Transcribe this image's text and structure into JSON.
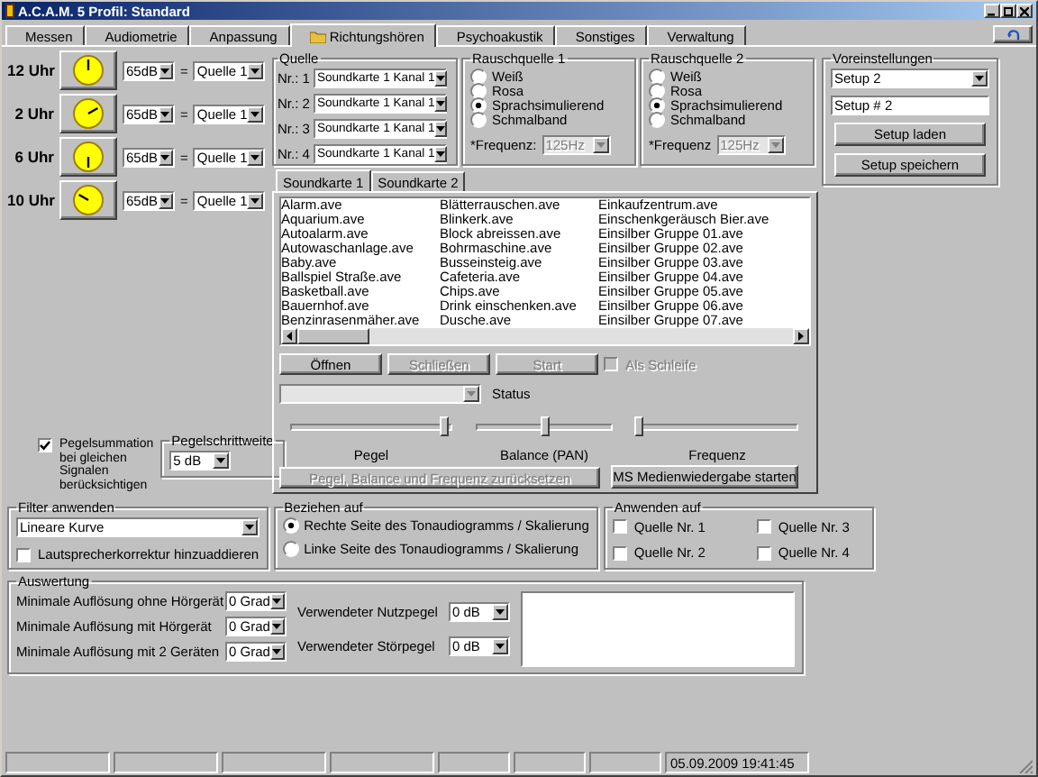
{
  "window": {
    "title": "A.C.A.M. 5 Profil: Standard"
  },
  "tabs": [
    {
      "label": "Messen",
      "selected": false
    },
    {
      "label": "Audiometrie",
      "selected": false
    },
    {
      "label": "Anpassung",
      "selected": false
    },
    {
      "label": "Richtungshören",
      "selected": true
    },
    {
      "label": "Psychoakustik",
      "selected": false
    },
    {
      "label": "Sonstiges",
      "selected": false
    },
    {
      "label": "Verwaltung",
      "selected": false
    }
  ],
  "clocks": [
    {
      "label": "12 Uhr",
      "kind": "twelve",
      "pegel": "65dB",
      "separator": "=",
      "source": "Quelle 1"
    },
    {
      "label": "2 Uhr",
      "kind": "two",
      "pegel": "65dB",
      "separator": "=",
      "source": "Quelle 1"
    },
    {
      "label": "6 Uhr",
      "kind": "six",
      "pegel": "65dB",
      "separator": "=",
      "source": "Quelle 1"
    },
    {
      "label": "10 Uhr",
      "kind": "ten",
      "pegel": "65dB",
      "separator": "=",
      "source": "Quelle 1"
    }
  ],
  "quelle": {
    "title": "Quelle",
    "rows": [
      {
        "label": "Nr.: 1",
        "value": "Soundkarte 1 Kanal 1"
      },
      {
        "label": "Nr.: 2",
        "value": "Soundkarte 1 Kanal 1"
      },
      {
        "label": "Nr.: 3",
        "value": "Soundkarte 1 Kanal 1"
      },
      {
        "label": "Nr.: 4",
        "value": "Soundkarte 1 Kanal 1"
      }
    ]
  },
  "rauschquelle_1": {
    "title": "Rauschquelle 1",
    "options": [
      {
        "label": "Weiß",
        "selected": false
      },
      {
        "label": "Rosa",
        "selected": false
      },
      {
        "label": "Sprachsimulierend",
        "selected": true
      },
      {
        "label": "Schmalband",
        "selected": false
      }
    ],
    "frequency": {
      "label": "*Frequenz:",
      "value": "125Hz",
      "disabled": true
    }
  },
  "rauschquelle_2": {
    "title": "Rauschquelle 2",
    "options": [
      {
        "label": "Weiß",
        "selected": false
      },
      {
        "label": "Rosa",
        "selected": false
      },
      {
        "label": "Sprachsimulierend",
        "selected": true
      },
      {
        "label": "Schmalband",
        "selected": false
      }
    ],
    "frequency": {
      "label": "*Frequenz",
      "value": "125Hz",
      "disabled": true
    }
  },
  "voreinstellungen": {
    "title": "Voreinstellungen",
    "select": "Setup 2",
    "name": "Setup # 2",
    "buttons": [
      "Setup laden",
      "Setup speichern"
    ]
  },
  "sound_tabs": [
    {
      "label": "Soundkarte 1",
      "selected": true
    },
    {
      "label": "Soundkarte 2",
      "selected": false
    }
  ],
  "file_list": {
    "columns": [
      [
        "Alarm.ave",
        "Aquarium.ave",
        "Autoalarm.ave",
        "Autowaschanlage.ave",
        "Baby.ave",
        "Ballspiel Straße.ave",
        "Basketball.ave",
        "Bauernhof.ave",
        "Benzinrasenmäher.ave"
      ],
      [
        "Blätterrauschen.ave",
        "Blinkerk.ave",
        "Block abreissen.ave",
        "Bohrmaschine.ave",
        "Busseinsteig.ave",
        "Cafeteria.ave",
        "Chips.ave",
        "Drink einschenken.ave",
        "Dusche.ave"
      ],
      [
        "Einkaufzentrum.ave",
        "Einschenkgeräusch Bier.ave",
        "Einsilber Gruppe 01.ave",
        "Einsilber Gruppe 02.ave",
        "Einsilber Gruppe 03.ave",
        "Einsilber Gruppe 04.ave",
        "Einsilber Gruppe 05.ave",
        "Einsilber Gruppe 06.ave",
        "Einsilber Gruppe 07.ave"
      ]
    ]
  },
  "player": {
    "buttons": [
      {
        "label": "Öffnen",
        "disabled": false
      },
      {
        "label": "Schließen",
        "disabled": true
      },
      {
        "label": "Start",
        "disabled": true
      }
    ],
    "loop": {
      "label": "Als Schleife",
      "checked": false,
      "disabled": true
    },
    "status_label": "Status",
    "sliders": [
      {
        "label": "Pegel",
        "level": 0.95
      },
      {
        "label": "Balance (PAN)",
        "level": 0.5
      },
      {
        "label": "Frequenz",
        "level": 0
      }
    ],
    "reset_button": {
      "label": "Pegel, Balance und Frequenz zurücksetzen",
      "disabled": true
    },
    "media_button": {
      "label": "MS Medienwiedergabe starten",
      "disabled": false
    }
  },
  "pegelsummation": {
    "label": "Pegelsummation bei gleichen Signalen berücksichtigen",
    "checked": true
  },
  "pegelschrittweite": {
    "title": "Pegelschrittweite",
    "value": "5 dB"
  },
  "filter": {
    "title": "Filter anwenden",
    "value": "Lineare Kurve",
    "checkbox": {
      "label": "Lautsprecherkorrektur hinzuaddieren",
      "checked": false
    }
  },
  "beziehen_auf": {
    "title": "Beziehen auf",
    "options": [
      {
        "label": "Rechte Seite des Tonaudiogramms / Skalierung",
        "selected": true
      },
      {
        "label": "Linke Seite des Tonaudiogramms / Skalierung",
        "selected": false
      }
    ]
  },
  "anwenden_auf": {
    "title": "Anwenden auf",
    "options": [
      {
        "label": "Quelle Nr. 1",
        "checked": false
      },
      {
        "label": "Quelle Nr. 2",
        "checked": false
      },
      {
        "label": "Quelle Nr. 3",
        "checked": false
      },
      {
        "label": "Quelle Nr. 4",
        "checked": false
      }
    ]
  },
  "auswertung": {
    "title": "Auswertung",
    "rows": [
      {
        "label": "Minimale Auflösung ohne Hörgerät",
        "value": "0 Grad"
      },
      {
        "label": "Minimale Auflösung mit Hörgerät",
        "value": "0 Grad"
      },
      {
        "label": "Minimale Auflösung mit 2 Geräten",
        "value": "0 Grad"
      }
    ],
    "pegel": [
      {
        "label": "Verwendeter Nutzpegel",
        "value": "0 dB"
      },
      {
        "label": "Verwendeter Störpegel",
        "value": "0 dB"
      }
    ]
  },
  "status_bar": {
    "timestamp": "05.09.2009 19:41:45"
  }
}
